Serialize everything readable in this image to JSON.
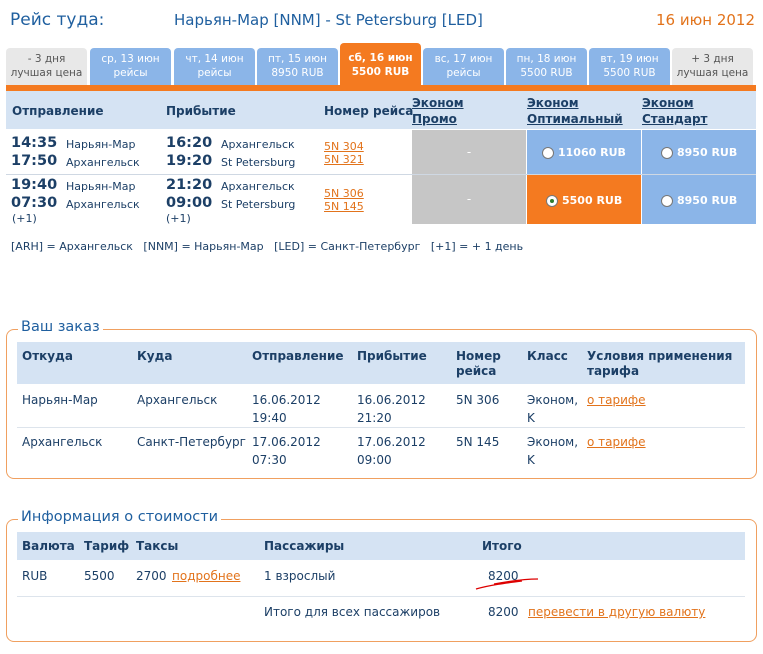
{
  "header": {
    "title": "Рейс туда:",
    "route": "Нарьян-Мар [NNM] - St Petersburg [LED]",
    "date": "16 июн 2012"
  },
  "date_tabs": [
    {
      "line1": "- 3 дня",
      "line2": "лучшая цена",
      "style": "grey"
    },
    {
      "line1": "ср, 13 июн",
      "line2": "рейсы",
      "style": "blue"
    },
    {
      "line1": "чт, 14 июн",
      "line2": "рейсы",
      "style": "blue"
    },
    {
      "line1": "пт, 15 июн",
      "line2": "8950 RUB",
      "style": "blue"
    },
    {
      "line1": "сб, 16 июн",
      "line2": "5500 RUB",
      "style": "active"
    },
    {
      "line1": "вс, 17 июн",
      "line2": "рейсы",
      "style": "blue"
    },
    {
      "line1": "пн, 18 июн",
      "line2": "5500 RUB",
      "style": "blue"
    },
    {
      "line1": "вт, 19 июн",
      "line2": "5500 RUB",
      "style": "blue"
    },
    {
      "line1": "+ 3 дня",
      "line2": "лучшая цена",
      "style": "grey"
    }
  ],
  "flights_table": {
    "headers": {
      "departure": "Отправление",
      "arrival": "Прибытие",
      "flight_no": "Номер рейса",
      "promo_1": "Эконом",
      "promo_2": "Промо",
      "optimal_1": "Эконом",
      "optimal_2": "Оптимальный",
      "standard_1": "Эконом",
      "standard_2": "Стандарт"
    },
    "rows": [
      {
        "dep1_time": "14:35",
        "dep1_city": "Нарьян-Мар",
        "dep2_time": "17:50",
        "dep2_city": "Архангельск",
        "arr1_time": "16:20",
        "arr1_city": "Архангельск",
        "arr2_time": "19:20",
        "arr2_city": "St Petersburg",
        "fn1": "5N 304",
        "fn2": "5N 321",
        "promo": "-",
        "optimal": "11060 RUB",
        "standard": "8950 RUB",
        "plus_dep": "",
        "plus_arr": ""
      },
      {
        "dep1_time": "19:40",
        "dep1_city": "Нарьян-Мар",
        "dep2_time": "07:30",
        "dep2_city": "Архангельск",
        "arr1_time": "21:20",
        "arr1_city": "Архангельск",
        "arr2_time": "09:00",
        "arr2_city": "St Petersburg",
        "fn1": "5N 306",
        "fn2": "5N 145",
        "promo": "-",
        "optimal": "5500 RUB",
        "standard": "8950 RUB",
        "plus_dep": "(+1)",
        "plus_arr": "(+1)"
      }
    ],
    "legend": "[ARH] = Архангельск   [NNM] = Нарьян-Мар   [LED] = Санкт-Петербург   [+1] = + 1 день"
  },
  "order": {
    "title": "Ваш заказ",
    "headers": {
      "from": "Откуда",
      "to": "Куда",
      "dep": "Отправление",
      "arr": "Прибытие",
      "fn_1": "Номер",
      "fn_2": "рейса",
      "class": "Класс",
      "terms_1": "Условия применения",
      "terms_2": "тарифа"
    },
    "rows": [
      {
        "from": "Нарьян-Мар",
        "to": "Архангельск",
        "dep_date": "16.06.2012",
        "dep_time": "19:40",
        "arr_date": "16.06.2012",
        "arr_time": "21:20",
        "fn": "5N 306",
        "class_1": "Эконом,",
        "class_2": "K",
        "terms": "о тарифе"
      },
      {
        "from": "Архангельск",
        "to": "Санкт-Петербург",
        "dep_date": "17.06.2012",
        "dep_time": "07:30",
        "arr_date": "17.06.2012",
        "arr_time": "09:00",
        "fn": "5N 145",
        "class_1": "Эконом,",
        "class_2": "K",
        "terms": "о тарифе"
      }
    ]
  },
  "cost": {
    "title": "Информация о стоимости",
    "headers": {
      "currency": "Валюта",
      "fare": "Тариф",
      "taxes": "Таксы",
      "passengers": "Пассажиры",
      "total": "Итого"
    },
    "row": {
      "currency": "RUB",
      "fare": "5500",
      "taxes": "2700",
      "taxes_link": "подробнее",
      "passengers": "1 взрослый",
      "total": "8200"
    },
    "all_label": "Итого для всех пассажиров",
    "all_total": "8200",
    "convert_link": "перевести в другую валюту"
  }
}
